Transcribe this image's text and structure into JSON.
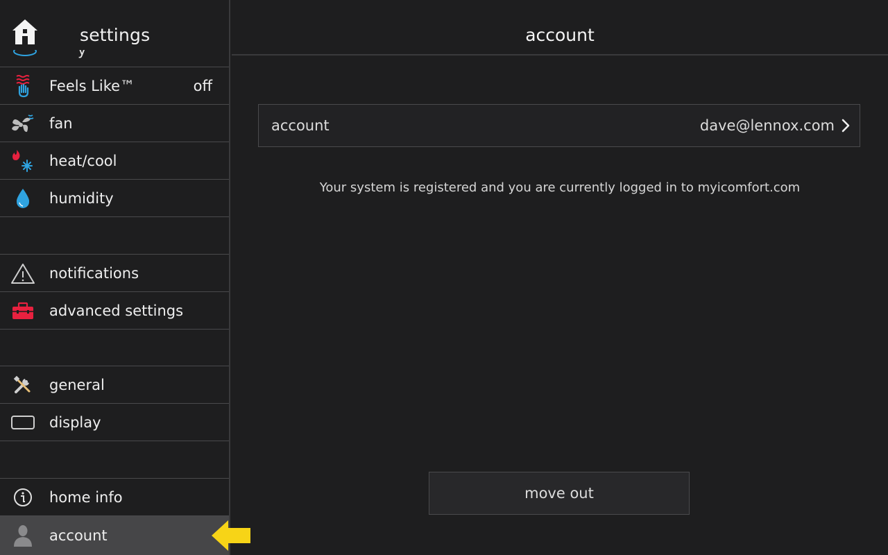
{
  "sidebar": {
    "title": "settings",
    "peek_label": "y",
    "items": [
      {
        "label": "Feels Like™",
        "value": "off",
        "icon": "feels-like-icon"
      },
      {
        "label": "fan",
        "icon": "fan-icon"
      },
      {
        "label": "heat/cool",
        "icon": "heat-cool-icon"
      },
      {
        "label": "humidity",
        "icon": "humidity-drop-icon"
      },
      {
        "label": "notifications",
        "icon": "warning-triangle-icon"
      },
      {
        "label": "advanced settings",
        "icon": "toolbox-icon"
      },
      {
        "label": "general",
        "icon": "tools-icon"
      },
      {
        "label": "display",
        "icon": "display-icon"
      },
      {
        "label": "home info",
        "icon": "info-icon"
      },
      {
        "label": "account",
        "icon": "user-icon",
        "active": true
      }
    ]
  },
  "main": {
    "title": "account",
    "account_row": {
      "label": "account",
      "value": "dave@lennox.com"
    },
    "status_text": "Your system is registered and you are currently logged in to myicomfort.com",
    "move_out_label": "move out"
  },
  "colors": {
    "background": "#1e1e1f",
    "active_row": "#464648",
    "divider": "#4a4a4c",
    "arrow": "#f7d417",
    "heat": "#e8213f",
    "cool": "#2fa3e0"
  }
}
